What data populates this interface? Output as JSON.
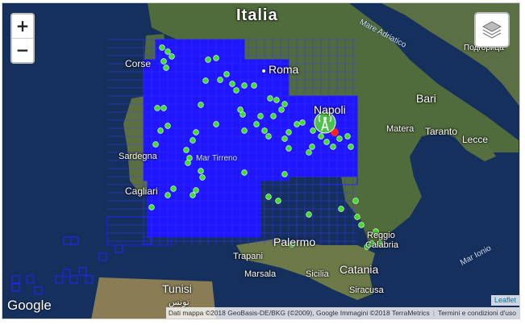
{
  "map": {
    "zoom_in_label": "+",
    "zoom_out_label": "−",
    "layers_icon": "layers-icon",
    "antenna_icon": "antenna-marker-icon",
    "colors": {
      "sea": "#16305e",
      "land": "#4f6b3e",
      "grid": "#1a1aff",
      "point": "#39e21f",
      "marker": "#ff2222"
    },
    "labels": {
      "country_italia": "Italia",
      "corse": "Corse",
      "roma": "Roma",
      "sardegna": "Sardegna",
      "cagliari": "Cagliari",
      "napoli": "Napoli",
      "bari": "Bari",
      "matera": "Matera",
      "taranto": "Taranto",
      "lecce": "Lecce",
      "palermo": "Palermo",
      "trapani": "Trapani",
      "marsala": "Marsala",
      "sicilia": "Sicilia",
      "catania": "Catania",
      "siracusa": "Siracusa",
      "reggio": "Reggio",
      "calabria": "Calabria",
      "tunisi": "Tunisi",
      "tunisi_arabic": "تونس",
      "podgorica": "Подгорица",
      "mar_tirreno": "Mar Tirreno",
      "mare_adriatico": "Mare Adriatico",
      "mar_ionio": "Mar Ionio"
    },
    "attribution": {
      "data": "Dati mappa ©2018 GeoBasis-DE/BKG (©2009), Google Immagini ©2018 TerraMetrics",
      "terms": "Termini e condizioni d'uso",
      "leaflet": "Leaflet",
      "google": "Google"
    }
  }
}
